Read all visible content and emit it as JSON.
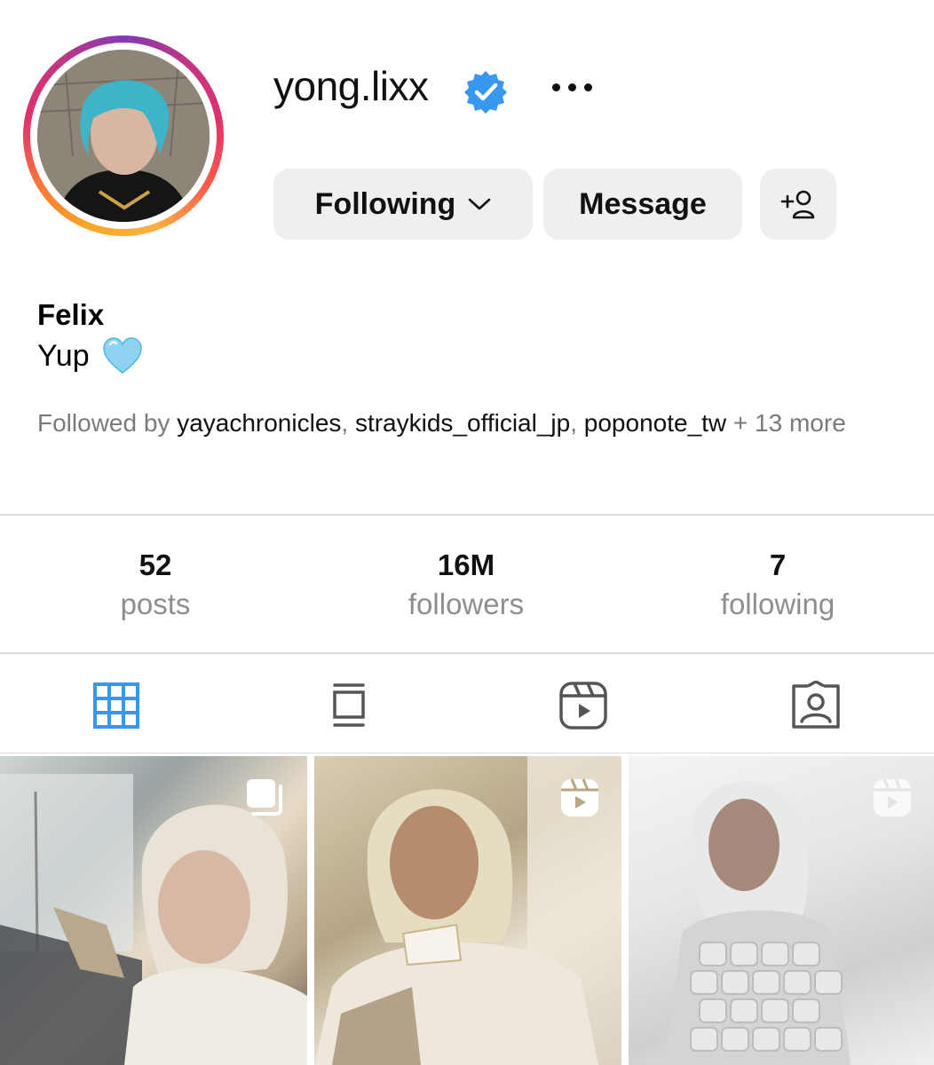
{
  "profile": {
    "username": "yong.lixx",
    "display_name": "Felix",
    "bio": "Yup",
    "bio_emoji": "light-blue-heart",
    "verified": true,
    "avatar_icon": "profile-photo"
  },
  "actions": {
    "following_label": "Following",
    "message_label": "Message",
    "add_user_icon": "add-person-icon",
    "more_icon": "ellipsis-icon"
  },
  "followed_by": {
    "prefix": "Followed by",
    "accounts": [
      "yayachronicles",
      "straykids_official_jp",
      "poponote_tw"
    ],
    "separator": ",",
    "more": "+ 13 more"
  },
  "stats": [
    {
      "value": "52",
      "label": "posts"
    },
    {
      "value": "16M",
      "label": "followers"
    },
    {
      "value": "7",
      "label": "following"
    }
  ],
  "tabs": [
    {
      "icon": "grid-icon",
      "active": true
    },
    {
      "icon": "feed-icon",
      "active": false
    },
    {
      "icon": "reels-icon",
      "active": false
    },
    {
      "icon": "tagged-icon",
      "active": false
    }
  ],
  "posts": [
    {
      "type_icon": "carousel-icon"
    },
    {
      "type_icon": "reel-icon"
    },
    {
      "type_icon": "reel-icon"
    }
  ],
  "colors": {
    "accent_blue": "#3897f0",
    "button_bg": "#efefef",
    "muted_text": "#8e8e8e",
    "divider": "#dbdbdb"
  }
}
